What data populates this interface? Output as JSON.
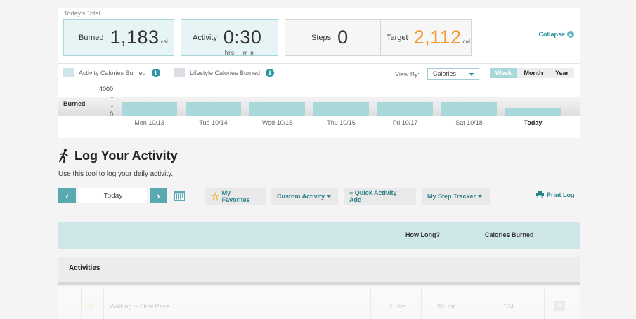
{
  "summary": {
    "today_label": "Today's Total",
    "burned": {
      "label": "Burned",
      "value": "1,183",
      "unit": "cal"
    },
    "activity": {
      "label": "Activity",
      "value": "0:30",
      "hrs": "hrs",
      "min": "min"
    },
    "steps": {
      "label": "Steps",
      "value": "0"
    },
    "target": {
      "label": "Target",
      "value": "2,112",
      "unit": "cal"
    },
    "collapse_label": "Collapse",
    "legend": [
      {
        "label": "Activity Calories Burned",
        "color": "#a9d8da"
      },
      {
        "label": "Lifestyle Calories Burned",
        "color": "#d9d2df"
      }
    ],
    "view_by_label": "View By:",
    "view_by_value": "Calories",
    "periods": {
      "week": "Week",
      "month": "Month",
      "year": "Year",
      "selected": "Week"
    }
  },
  "chart_data": {
    "type": "bar",
    "row_label": "Burned",
    "categories": [
      "Mon 10/13",
      "Tue 10/14",
      "Wed 10/15",
      "Thu 10/16",
      "Fri 10/17",
      "Sat 10/18",
      "Today"
    ],
    "series": [
      {
        "values": [
          2100,
          2100,
          2100,
          2100,
          2100,
          2100,
          1183
        ]
      }
    ],
    "ylim": [
      0,
      4000
    ],
    "yticks": [
      "4000",
      "-",
      "-",
      "0"
    ],
    "colors": [
      "#a9d8da"
    ]
  },
  "log": {
    "title": "Log Your Activity",
    "intro": "Use this tool to log your daily activity.",
    "prev_icon": "‹",
    "next_icon": "›",
    "date_value": "Today",
    "favorites_label": "My Favorites",
    "custom_label": "Custom Activity",
    "quick_add_label": "+ Quick Activity Add",
    "step_tracker_label": "My Step Tracker",
    "print_label": "Print Log",
    "columns": {
      "how_long": "How Long?",
      "calories": "Calories Burned"
    },
    "section_title": "Activities",
    "rows": [
      {
        "name": "Walking -- Slow Pace",
        "hrs_value": "0",
        "hrs_unit": "hrs",
        "min_value": "30",
        "min_unit": "min",
        "calories": "104"
      }
    ]
  }
}
